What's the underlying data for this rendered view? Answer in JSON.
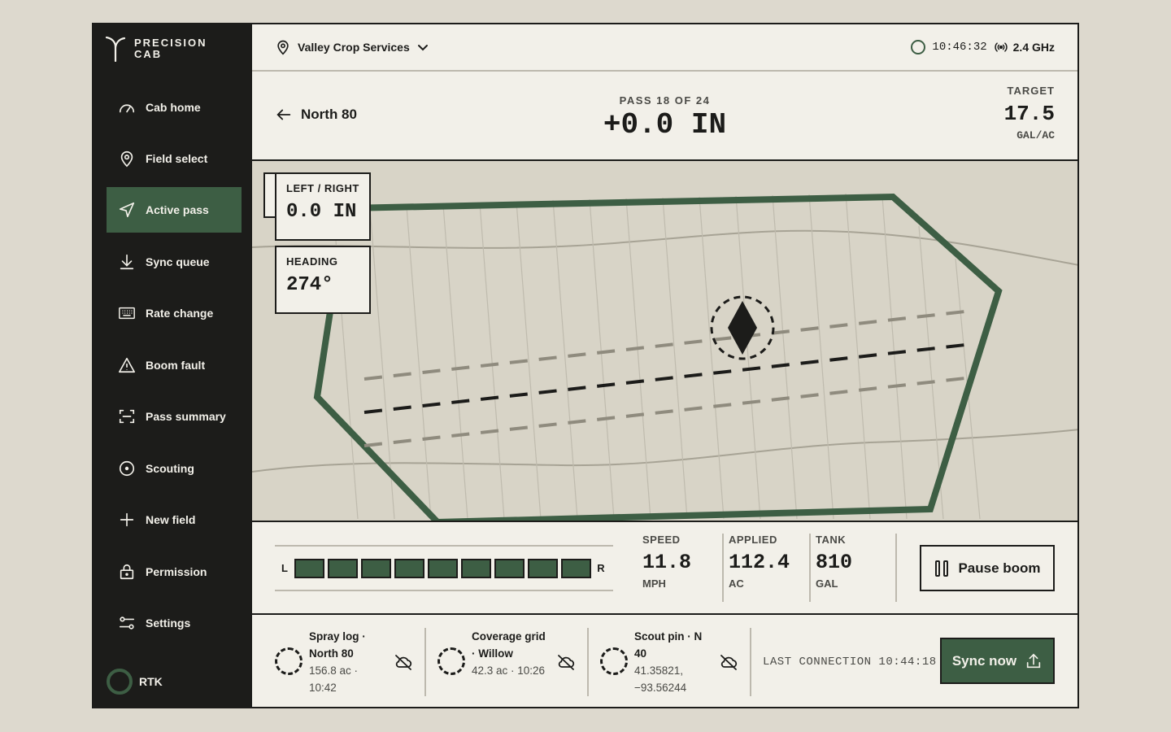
{
  "brand": {
    "line1": "PRECISION",
    "line2": "CAB",
    "icon": "sprout-logo-icon"
  },
  "sidebar": {
    "items": [
      {
        "label": "Cab home",
        "icon": "gauge-icon",
        "active": false
      },
      {
        "label": "Field select",
        "icon": "map-pin-icon",
        "active": false
      },
      {
        "label": "Active pass",
        "icon": "navigation-icon",
        "active": true
      },
      {
        "label": "Sync queue",
        "icon": "download-icon",
        "active": false
      },
      {
        "label": "Rate change",
        "icon": "keyboard-icon",
        "active": false
      },
      {
        "label": "Boom fault",
        "icon": "warning-icon",
        "active": false
      },
      {
        "label": "Pass summary",
        "icon": "scan-icon",
        "active": false
      },
      {
        "label": "Scouting",
        "icon": "target-icon",
        "active": false
      },
      {
        "label": "New field",
        "icon": "plus-icon",
        "active": false
      },
      {
        "label": "Permission",
        "icon": "lock-icon",
        "active": false
      },
      {
        "label": "Settings",
        "icon": "sliders-icon",
        "active": false
      }
    ],
    "rtk_label": "RTK"
  },
  "topbar": {
    "org_name": "Valley Crop Services",
    "time": "10:46:32",
    "radio": "2.4 GHz"
  },
  "header": {
    "field_name": "North 80",
    "pass_label": "PASS 18 OF 24",
    "offset": "+0.0 IN",
    "target_label": "TARGET",
    "target_value": "17.5",
    "target_unit": "GAL/AC"
  },
  "map": {
    "left_right_label": "LEFT / RIGHT",
    "left_right_value": "0.0 IN",
    "heading_label": "HEADING",
    "heading_value": "274°"
  },
  "boom": {
    "left_label": "L",
    "right_label": "R",
    "section_count": 9,
    "sections_on": 9,
    "speed_label": "SPEED",
    "speed_value": "11.8",
    "speed_unit": "MPH",
    "applied_label": "APPLIED",
    "applied_value": "112.4",
    "applied_unit": "AC",
    "tank_label": "TANK",
    "tank_value": "810",
    "tank_unit": "GAL",
    "pause_label": "Pause boom"
  },
  "sync": {
    "items": [
      {
        "title": "Spray log · North 80",
        "meta": "156.8 ac · 10:42"
      },
      {
        "title": "Coverage grid · Willow",
        "meta": "42.3 ac · 10:26"
      },
      {
        "title": "Scout pin · N 40",
        "meta": "41.35821, −93.56244"
      }
    ],
    "last_connection": "LAST CONNECTION 10:44:18",
    "button_label": "Sync now"
  },
  "colors": {
    "accent": "#3d5e44",
    "ink": "#1c1c1a",
    "paper": "#f2f0e9",
    "map_bg": "#d8d4c7",
    "page_bg": "#ddd9ce"
  }
}
